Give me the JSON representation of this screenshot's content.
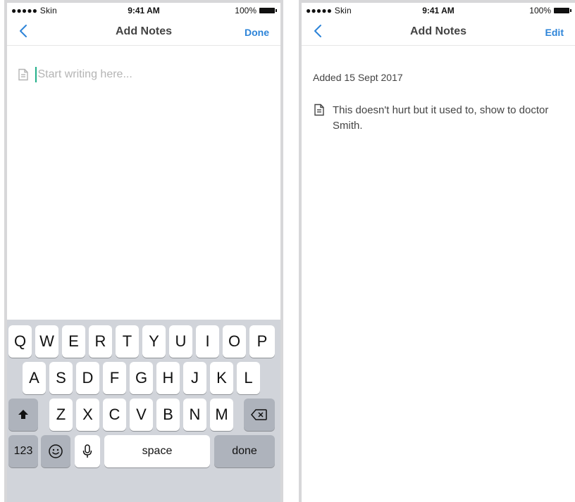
{
  "status": {
    "carrier": "●●●●● Skin",
    "time": "9:41 AM",
    "battery": "100%"
  },
  "left_screen": {
    "nav": {
      "title": "Add Notes",
      "action": "Done"
    },
    "editor": {
      "placeholder": "Start writing here..."
    },
    "keyboard": {
      "row1": [
        "Q",
        "W",
        "E",
        "R",
        "T",
        "Y",
        "U",
        "I",
        "O",
        "P"
      ],
      "row2": [
        "A",
        "S",
        "D",
        "F",
        "G",
        "H",
        "J",
        "K",
        "L"
      ],
      "row3": [
        "Z",
        "X",
        "C",
        "V",
        "B",
        "N",
        "M"
      ],
      "numbers_key": "123",
      "space_key": "space",
      "done_key": "done"
    }
  },
  "right_screen": {
    "nav": {
      "title": "Add Notes",
      "action": "Edit"
    },
    "added_date": "Added 15 Sept  2017",
    "note_text": "This doesn't hurt but it used to, show to doctor Smith."
  },
  "colors": {
    "accent": "#2d84d8",
    "caret": "#23b08a",
    "keyboard_bg": "#d1d4da"
  }
}
